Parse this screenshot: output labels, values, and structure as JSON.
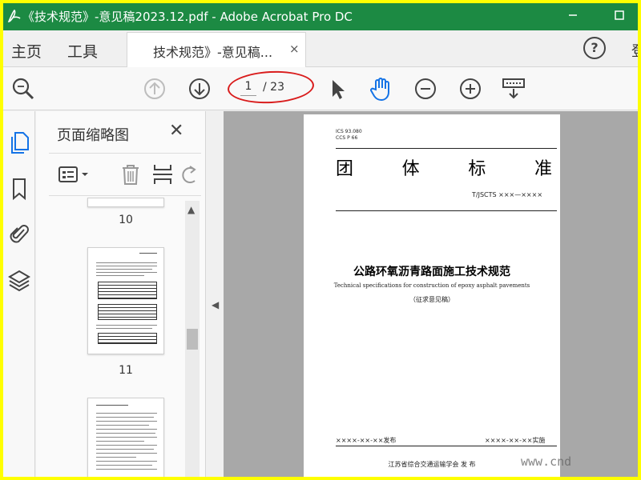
{
  "window": {
    "title": "《技术规范》-意见稿2023.12.pdf - Adobe Acrobat Pro DC",
    "minimize_icon": "minimize-icon",
    "maximize_icon": "maximize-icon"
  },
  "menu": {
    "home": "主页",
    "tools": "工具",
    "doc_tab": "技术规范》-意见稿...",
    "doc_tab_close": "×",
    "help": "?",
    "sign": "登"
  },
  "toolbar": {
    "current_page": "1",
    "total_pages": "/ 23",
    "icons": [
      "search-icon",
      "prev-page-icon",
      "next-page-icon",
      "select-arrow-icon",
      "hand-tool-icon",
      "zoom-out-icon",
      "zoom-in-icon",
      "keyboard-icon"
    ]
  },
  "sidebar": {
    "icons": [
      "pages-icon",
      "bookmark-icon",
      "attachment-icon",
      "layers-icon"
    ]
  },
  "thumbnails": {
    "title": "页面缩略图",
    "close": "✕",
    "pages": [
      {
        "num": "10"
      },
      {
        "num": "11"
      }
    ]
  },
  "document": {
    "ics": "ICS  93.080",
    "ccs": "CCS  P 66",
    "heading_chars": [
      "团",
      "体",
      "标",
      "准"
    ],
    "code": "T/JSCTS  ×××—××××",
    "title": "公路环氧沥青路面施工技术规范",
    "subtitle": "Technical specifications for construction of epoxy asphalt pavements",
    "draft": "（征求意见稿）",
    "issue_date": "××××-××-××发布",
    "impl_date": "××××-××-××实施",
    "publisher": "江苏省综合交通运输学会    发  布"
  },
  "watermark": "www.cnd"
}
